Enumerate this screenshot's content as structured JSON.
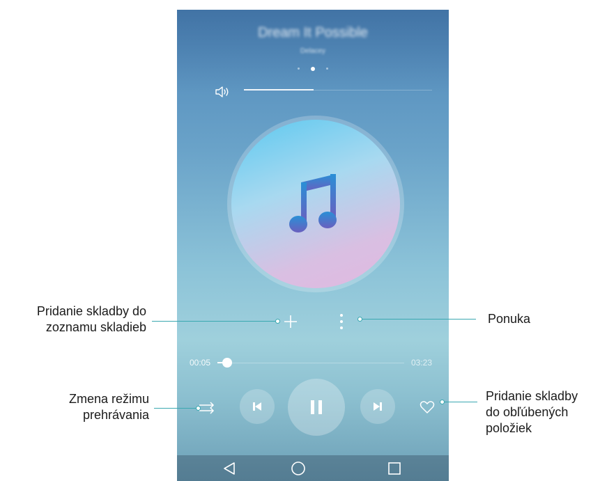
{
  "player": {
    "song_title": "Dream It Possible",
    "song_artist": "Delacey",
    "page_dots": 3,
    "active_dot": 1,
    "volume_level": 0.37,
    "elapsed_time": "00:05",
    "total_time": "03:23",
    "progress": 0.025
  },
  "icons": {
    "volume": "speaker-icon",
    "album": "music-note-icon",
    "add": "plus-icon",
    "menu": "more-vertical-icon",
    "shuffle": "play-mode-icon",
    "previous": "skip-previous-icon",
    "play_pause": "pause-icon",
    "next": "skip-next-icon",
    "favorite": "heart-icon",
    "nav_back": "back-triangle-icon",
    "nav_home": "home-circle-icon",
    "nav_recent": "recent-square-icon"
  },
  "callouts": {
    "add_to_playlist": [
      "Pridanie skladby do",
      "zoznamu skladieb"
    ],
    "menu": [
      "Ponuka"
    ],
    "play_mode": [
      "Zmena režimu",
      "prehrávania"
    ],
    "add_to_favorites": [
      "Pridanie skladby",
      "do obľúbených",
      "položiek"
    ]
  },
  "colors": {
    "callout_line": "#3aa8b0",
    "background_top": "#4f86b8",
    "background_mid": "#9fd0dc"
  }
}
